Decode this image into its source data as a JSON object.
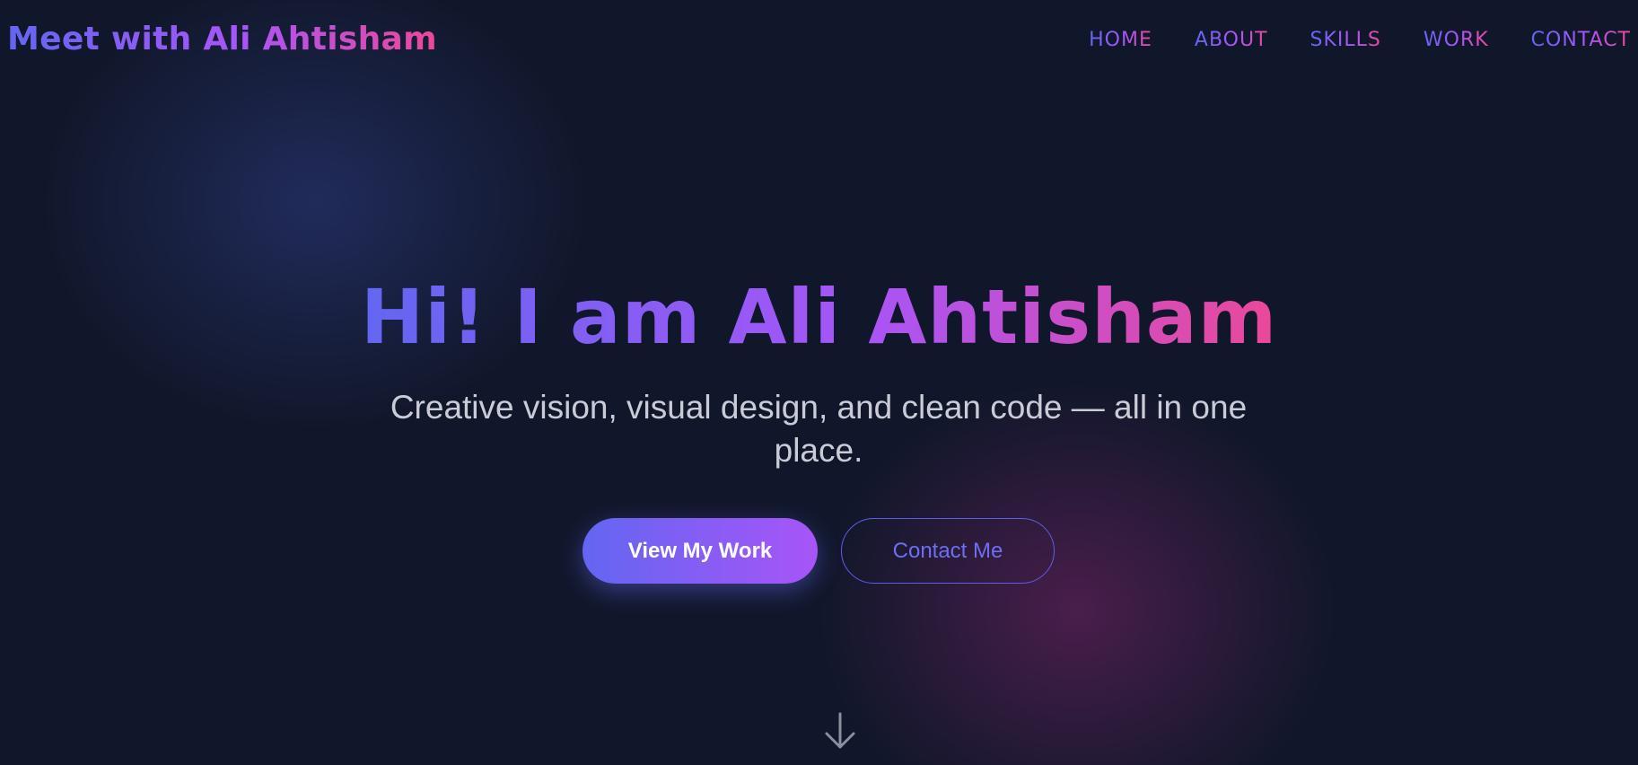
{
  "header": {
    "logo_text": "Meet with Ali Ahtisham",
    "nav": [
      {
        "label": "HOME"
      },
      {
        "label": "ABOUT"
      },
      {
        "label": "SKILLS"
      },
      {
        "label": "WORK"
      },
      {
        "label": "CONTACT"
      }
    ]
  },
  "hero": {
    "title": "Hi! I am Ali Ahtisham",
    "subtitle": "Creative vision, visual design, and clean code — all in one place.",
    "primary_button": "View My Work",
    "secondary_button": "Contact Me",
    "scroll_icon": "arrow-down-icon"
  },
  "colors": {
    "background": "#11172b",
    "gradient_start": "#6366f1",
    "gradient_mid": "#a855f7",
    "gradient_end": "#ec4899",
    "subtitle_text": "#c9ccd6",
    "outline_button": "#6c6ff2"
  }
}
